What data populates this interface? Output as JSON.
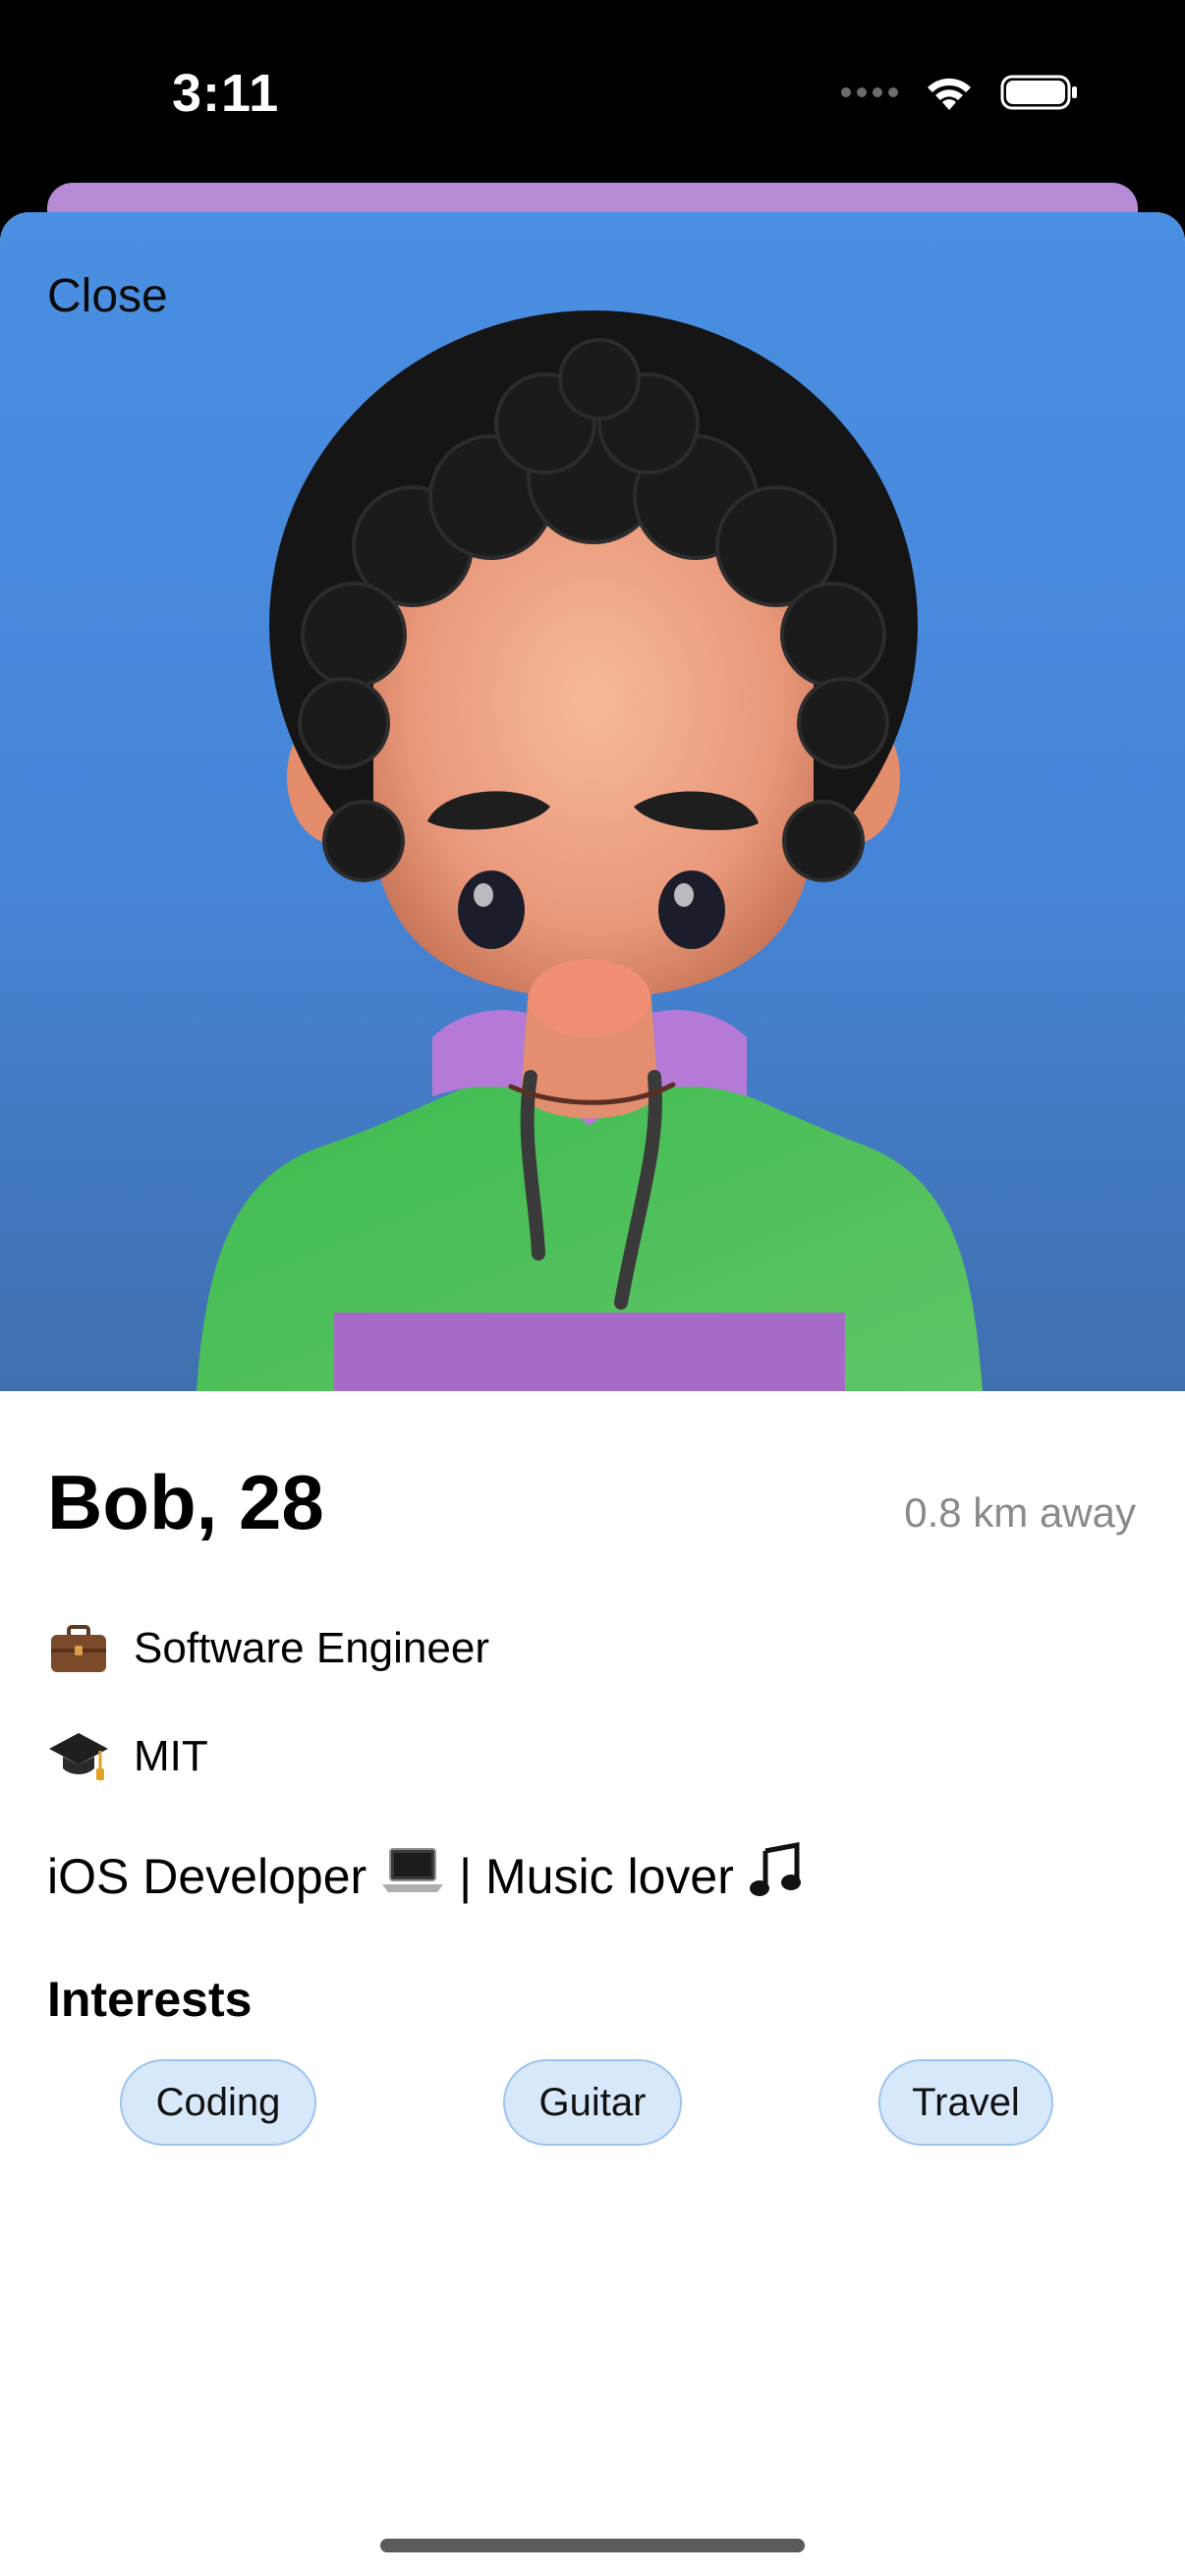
{
  "status_bar": {
    "time": "3:11",
    "icons": [
      "cellular-dots-icon",
      "wifi-icon",
      "battery-icon"
    ]
  },
  "modal": {
    "close_label": "Close",
    "hero_image": "avatar-illustration-curly-hair-green-hoodie"
  },
  "profile": {
    "name_age": "Bob, 28",
    "distance": "0.8 km away",
    "job": {
      "icon": "briefcase-icon",
      "text": "Software Engineer"
    },
    "school": {
      "icon": "graduation-cap-icon",
      "text": "MIT"
    },
    "bio": {
      "part1": "iOS Developer",
      "icon1": "laptop-icon",
      "part2": "| Music lover",
      "icon2": "music-note-icon"
    }
  },
  "interests": {
    "title": "Interests",
    "items": [
      "Coding",
      "Guitar",
      "Travel"
    ]
  },
  "colors": {
    "hero_bg": "#4a8fe3",
    "chip_bg": "#d8e8fb",
    "chip_border": "#9cc4f0",
    "secondary_text": "#8a8a8e",
    "peek_sheet": "#b58bd6"
  }
}
